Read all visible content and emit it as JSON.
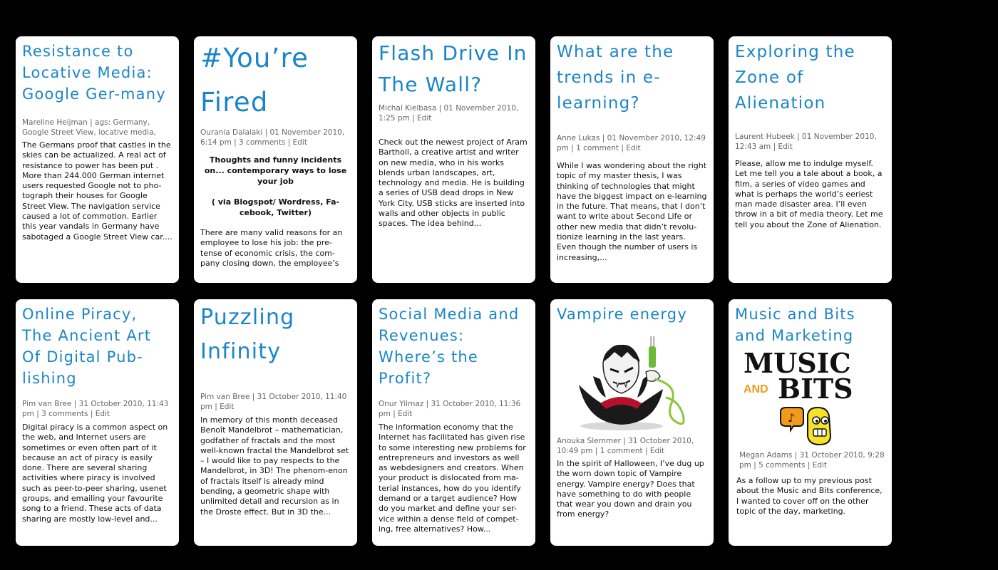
{
  "posts": [
    {
      "title": "Resistance to Locative Media: Google Ger-many",
      "meta": "Mareline Heijman | ags: Germany, Google Street View, locative media,",
      "comments": "",
      "edit": "",
      "excerpt": "The Germans proof that castles in the skies can be actualized. A real act of resistance to power has been put . More than 244.000 German internet users requested Google not to pho-tograph their houses for Google Street View. The navigation service caused a lot of commotion. Earlier this year vandals in Germany have sabotaged a Google Street View car...."
    },
    {
      "title": "#You’re Fired",
      "meta": "Ourania Dalalaki | 01 November 2010, 6:14 pm",
      "comments": "3 comments",
      "edit": "Edit",
      "subtitle": "Thoughts and funny incidents on... contemporary ways to lose your job",
      "subtitle2": "( via Blogspot/ Wordress, Fa-cebook, Twitter)",
      "excerpt": "There are many valid reasons for an employee to lose his job: the pre-tense of economic crisis, the com-pany closing down, the employee’s"
    },
    {
      "title": "Flash Drive In The Wall?",
      "meta": "Michal Kielbasa | 01 November 2010, 1:25 pm",
      "comments": "",
      "edit": "Edit",
      "excerpt": "Check out the newest project of Aram Bartholl, a creative artist and writer on new media, who in his works blends urban landscapes, art, technology and media. He is building a series of USB dead drops in New York City. USB sticks are inserted into walls and other objects in public spaces. The idea behind..."
    },
    {
      "title": "What are the trends in e-learning?",
      "meta": "Anne Lukas | 01 November 2010, 12:49 pm",
      "comments": "1 comment",
      "edit": "Edit",
      "excerpt": "While I was wondering about the right topic of my master thesis, I was thinking of technologies that might have the biggest impact on e-learning in the future. That means, that I don’t want to write about Second Life or other new media that didn’t revolu-tionize learning in the last years. Even though the number of users is increasing,..."
    },
    {
      "title": "Exploring the Zone of Alienation",
      "meta": "Laurent Hubeek | 01 November 2010, 12:43 am",
      "comments": "",
      "edit": "Edit",
      "excerpt": "Please, allow me to indulge myself. Let me tell you a tale about a book, a film, a series of video games and what is perhaps the world’s eeriest man made disaster area. I’ll even throw in a bit of media theory. Let me tell you about the Zone of Alienation."
    },
    {
      "title": "Online Piracy, The Ancient Art Of Digital Pub-lishing",
      "meta": "Pim van Bree | 31 October 2010, 11:43 pm",
      "comments": "3 comments",
      "edit": "Edit",
      "excerpt": "Digital piracy is a common aspect on the web, and Internet users are sometimes or even often part of it because an act of piracy is easily done. There are several sharing activities where piracy is involved such as peer-to-peer sharing, usenet groups, and emailing your favourite song to a friend. These acts of data sharing are mostly low-level and..."
    },
    {
      "title": "Puzzling Infinity",
      "meta": "Pim van Bree | 31 October 2010, 11:40 pm",
      "comments": "",
      "edit": "Edit",
      "excerpt": "In memory of this month deceased Benoît Mandelbrot – mathematician, godfather of fractals and the most well-known fractal the Mandelbrot set – I would like to pay respects to the Mandelbrot, in 3D! The phenom-enon of fractals itself is already mind bending, a geometric shape with unlimited detail and recursion as in the Droste effect. But in 3D the..."
    },
    {
      "title": "Social Media and Revenues: Where’s the Profit?",
      "meta": "Onur Yilmaz | 31 October 2010, 11:36 pm",
      "comments": "",
      "edit": "Edit",
      "excerpt": "The information economy that the Internet has facilitated has given rise to some interesting new problems for entrepreneurs and investors as well as webdesigners and creators. When your product is dislocated from ma-terial instances, how do you identify demand or a target audience? How do you market and define your ser-vice within a dense field of compet-ing, free alternatives? How..."
    },
    {
      "title": "Vampire energy",
      "meta": "Anouka Slemmer | 31 October 2010, 10:49 pm",
      "comments": "1 comment",
      "edit": "Edit",
      "excerpt": "In the spirit of Halloween, I’ve dug up the worn down topic of Vampire energy. Vampire energy? Does that have something to do with people that wear you down and drain you from energy?"
    },
    {
      "title": "Music and Bits and Marketing",
      "meta": "Megan Adams | 31 October 2010, 9:28 pm",
      "comments": "5 comments",
      "edit": "Edit",
      "logo_line1": "MUSIC",
      "logo_and": "AND",
      "logo_line2": "BITS",
      "excerpt": "As a follow up to my previous post about the Music and Bits conference, I wanted to cover off on the other topic of the day, marketing."
    }
  ],
  "colors": {
    "title": "#1a85c8",
    "background": "#000000",
    "card": "#ffffff"
  }
}
